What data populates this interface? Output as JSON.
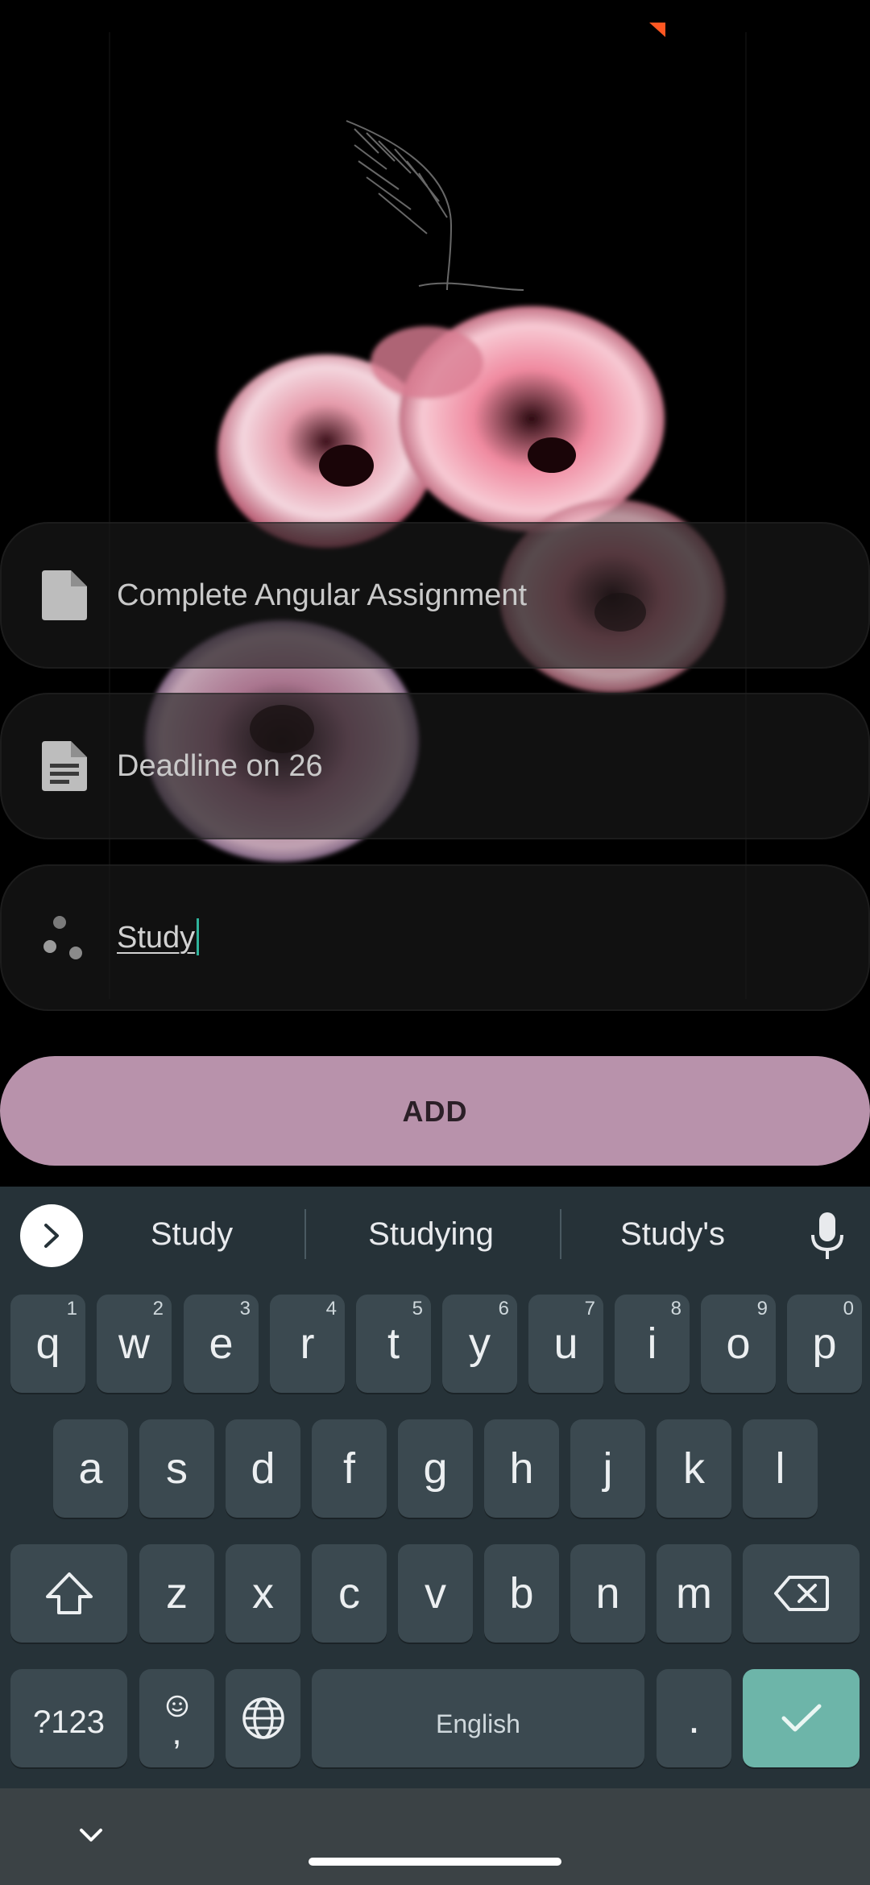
{
  "colors": {
    "add_button_bg": "#b892ab",
    "keyboard_bg": "#263238",
    "key_bg": "#3b4950",
    "enter_key_bg": "#6db5a9",
    "caret": "#2fb39b"
  },
  "form": {
    "title_field": {
      "icon": "note-icon",
      "value": "Complete Angular Assignment"
    },
    "description_field": {
      "icon": "notes-lines-icon",
      "value": "Deadline on 26"
    },
    "category_field": {
      "icon": "category-dots-icon",
      "value": "Study"
    },
    "add_button_label": "ADD"
  },
  "keyboard": {
    "suggestions": [
      "Study",
      "Studying",
      "Study's"
    ],
    "row1": [
      {
        "k": "q",
        "h": "1"
      },
      {
        "k": "w",
        "h": "2"
      },
      {
        "k": "e",
        "h": "3"
      },
      {
        "k": "r",
        "h": "4"
      },
      {
        "k": "t",
        "h": "5"
      },
      {
        "k": "y",
        "h": "6"
      },
      {
        "k": "u",
        "h": "7"
      },
      {
        "k": "i",
        "h": "8"
      },
      {
        "k": "o",
        "h": "9"
      },
      {
        "k": "p",
        "h": "0"
      }
    ],
    "row2": [
      "a",
      "s",
      "d",
      "f",
      "g",
      "h",
      "j",
      "k",
      "l"
    ],
    "row3": [
      "z",
      "x",
      "c",
      "v",
      "b",
      "n",
      "m"
    ],
    "symbols_key": "?123",
    "emoji_comma_key": ",",
    "space_label": "English",
    "period_key": "."
  }
}
